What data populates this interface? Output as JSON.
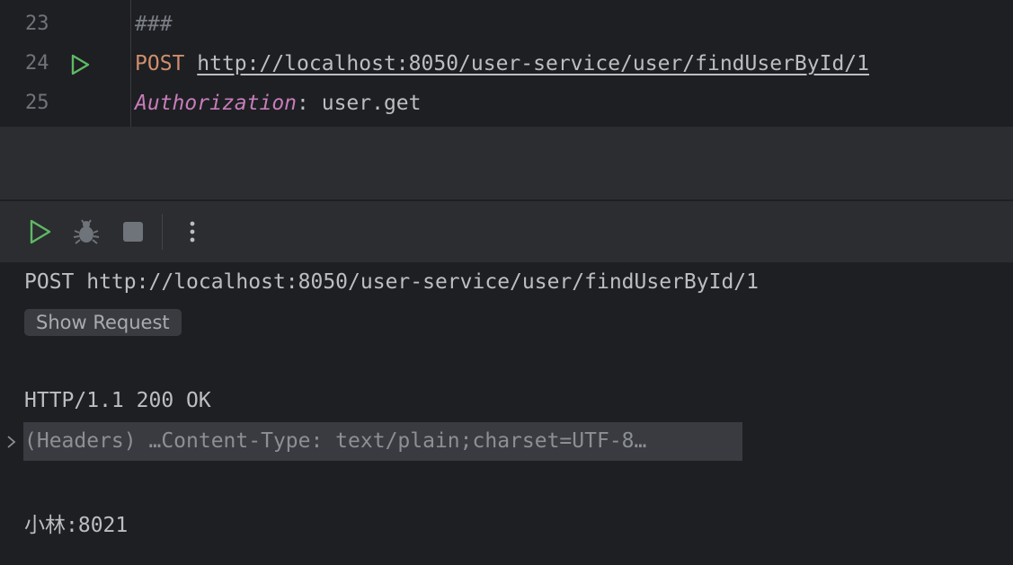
{
  "editor": {
    "lines": [
      {
        "number": "23",
        "text": "###"
      },
      {
        "number": "24",
        "method": "POST",
        "url": "http://localhost:8050/user-service/user/findUserById/1"
      },
      {
        "number": "25",
        "header_key": "Authorization",
        "separator": ": ",
        "header_value": "user.get"
      }
    ],
    "run_icon": "run-request-icon"
  },
  "toolbar": {
    "icons": [
      "run-icon",
      "debug-icon",
      "stop-icon",
      "more-options-icon"
    ],
    "more_label": "⋮"
  },
  "console": {
    "request_line": "POST http://localhost:8050/user-service/user/findUserById/1",
    "show_request_label": "Show Request",
    "status_line": "HTTP/1.1 200 OK",
    "headers_summary": "(Headers) …Content-Type: text/plain;charset=UTF-8…",
    "body": "小林:8021"
  },
  "colors": {
    "accent_green": "#5fb865",
    "method_orange": "#cf8e6d",
    "header_key_purple": "#c77dbb"
  }
}
